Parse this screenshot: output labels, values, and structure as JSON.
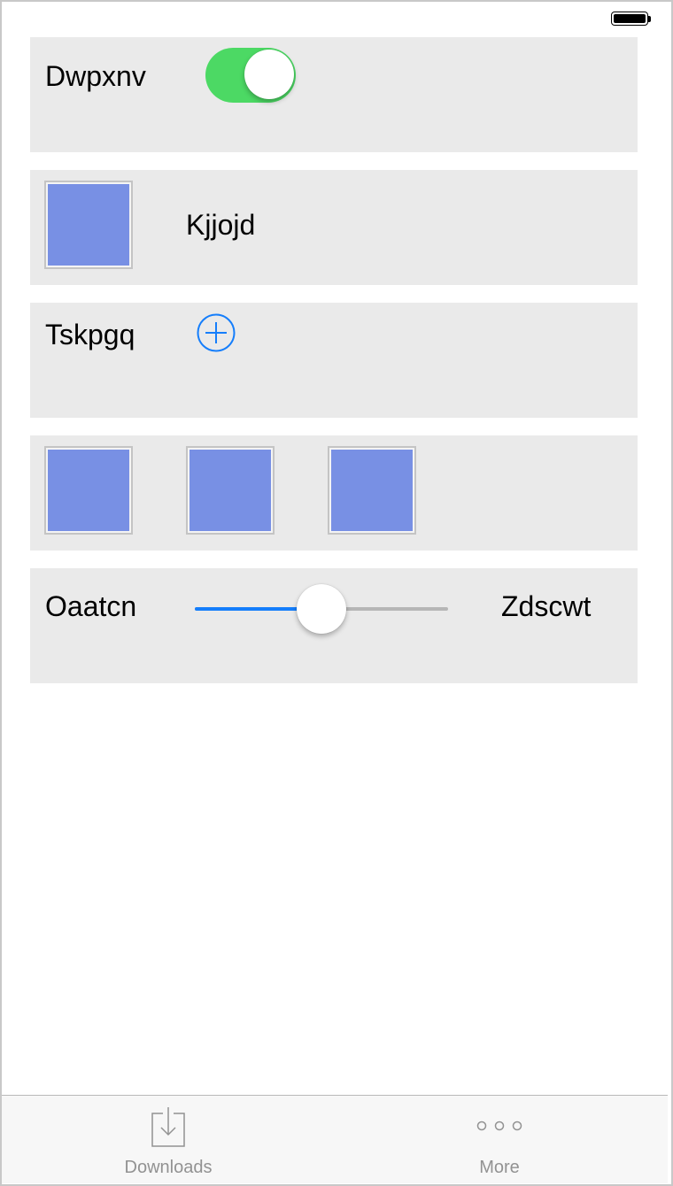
{
  "status_bar": {
    "battery_icon": "battery-full-icon"
  },
  "rows": {
    "toggle_row": {
      "label": "Dwpxnv",
      "toggle_on": true,
      "toggle_color": "#4cd964"
    },
    "image_row": {
      "label": "Kjjojd"
    },
    "add_row": {
      "label": "Tskpgq",
      "button_icon": "plus-circle-icon",
      "accent": "#157efb"
    },
    "slider_row": {
      "min_label": "Oaatcn",
      "max_label": "Zdscwt",
      "value_fraction": 0.5,
      "accent": "#157efb"
    }
  },
  "swatch_color": "#7890e4",
  "tab_bar": {
    "tabs": [
      {
        "label": "Downloads",
        "icon": "download-icon"
      },
      {
        "label": "More",
        "icon": "more-dots-icon"
      }
    ]
  }
}
